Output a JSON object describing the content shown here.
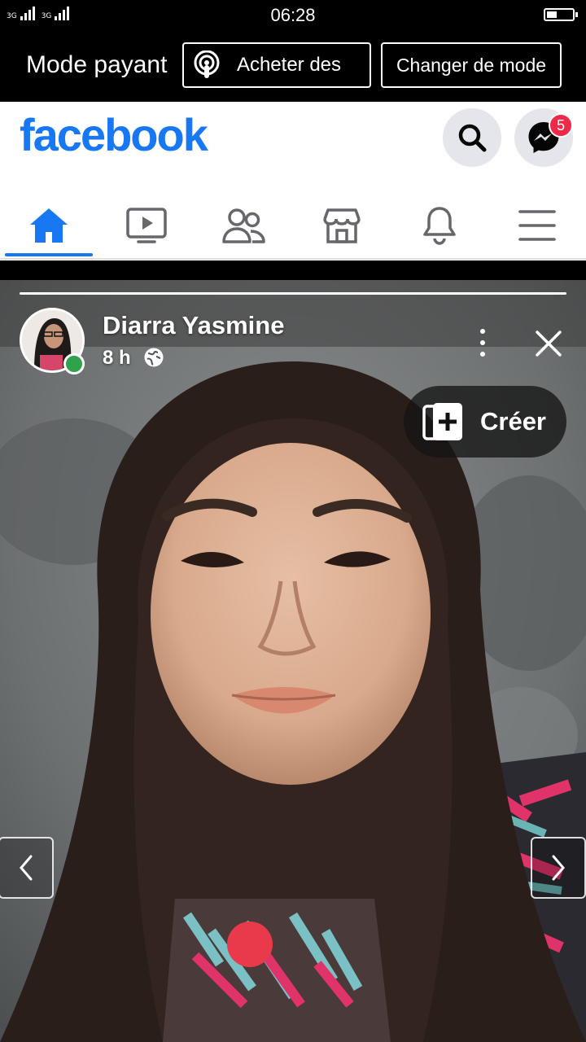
{
  "status_bar": {
    "signal_1_label": "3G",
    "signal_2_label": "3G",
    "time": "06:28",
    "battery_level_percent": 40
  },
  "data_mode": {
    "label": "Mode payant",
    "buy_label": "Acheter des",
    "switch_label": "Changer de mode"
  },
  "header": {
    "logo": "facebook",
    "search_icon": "search-icon",
    "messenger_icon": "messenger-icon",
    "messenger_badge": "5",
    "brand_color": "#1877f2",
    "badge_color": "#f02849"
  },
  "nav": {
    "tabs": [
      {
        "icon": "home-icon",
        "active": true
      },
      {
        "icon": "video-icon",
        "active": false
      },
      {
        "icon": "friends-icon",
        "active": false
      },
      {
        "icon": "marketplace-icon",
        "active": false
      },
      {
        "icon": "bell-icon",
        "active": false
      },
      {
        "icon": "menu-icon",
        "active": false
      }
    ]
  },
  "story": {
    "author": "Diarra Yasmine",
    "time": "8 h",
    "audience_icon": "globe-icon",
    "create_label": "Créer",
    "online_color": "#31a24c"
  }
}
